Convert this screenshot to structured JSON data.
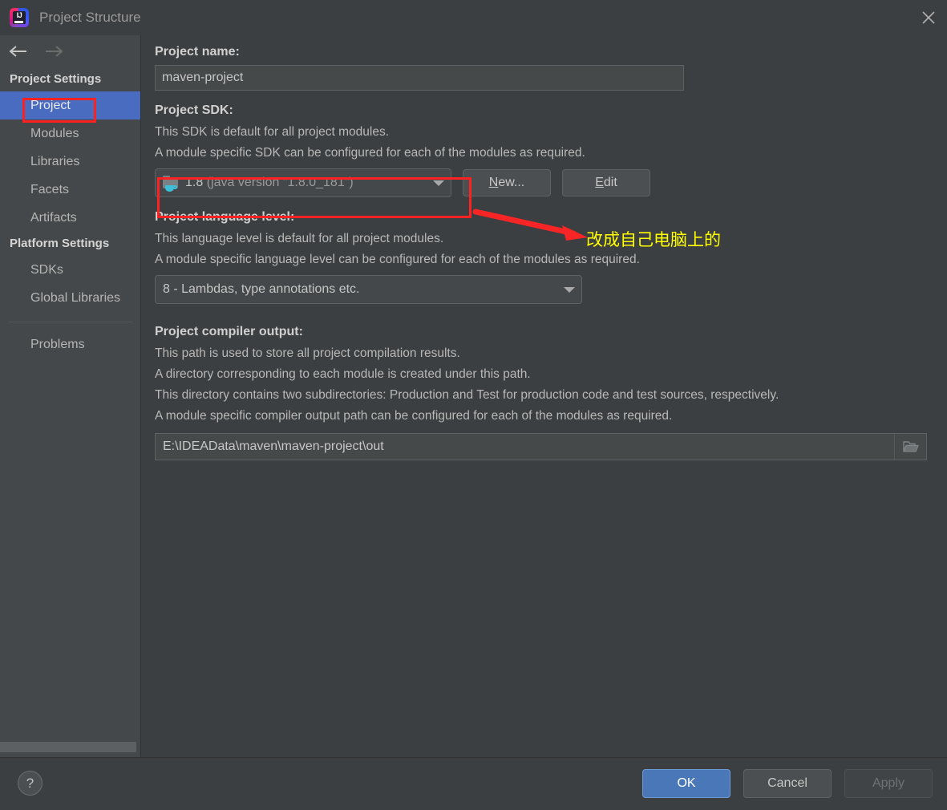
{
  "window": {
    "title": "Project Structure",
    "logo_icon": "intellij-idea-logo",
    "close_icon": "close-icon"
  },
  "sidebar": {
    "back_icon": "arrow-left-icon",
    "forward_icon": "arrow-right-icon",
    "groups": [
      {
        "header": "Project Settings",
        "items": [
          {
            "label": "Project",
            "selected": true
          },
          {
            "label": "Modules",
            "selected": false
          },
          {
            "label": "Libraries",
            "selected": false
          },
          {
            "label": "Facets",
            "selected": false
          },
          {
            "label": "Artifacts",
            "selected": false
          }
        ]
      },
      {
        "header": "Platform Settings",
        "items": [
          {
            "label": "SDKs",
            "selected": false
          },
          {
            "label": "Global Libraries",
            "selected": false
          }
        ]
      }
    ],
    "problems_label": "Problems"
  },
  "main": {
    "project_name": {
      "label": "Project name:",
      "value": "maven-project",
      "placeholder": "Project name"
    },
    "project_sdk": {
      "label": "Project SDK:",
      "description_line1": "This SDK is default for all project modules.",
      "description_line2": "A module specific SDK can be configured for each of the modules as required.",
      "selected_version": "1.8",
      "selected_detail": "(java version \"1.8.0_181\")",
      "sdk_icon": "java-sdk-folder-icon",
      "dropdown_icon": "chevron-down-icon",
      "new_button": "New...",
      "new_button_mnemonic": "N",
      "new_button_rest": "ew...",
      "edit_button": "Edit",
      "edit_button_mnemonic": "E",
      "edit_button_rest": "dit"
    },
    "language_level": {
      "label": "Project language level:",
      "description_line1": "This language level is default for all project modules.",
      "description_line2": "A module specific language level can be configured for each of the modules as required.",
      "value": "8 - Lambdas, type annotations etc.",
      "dropdown_icon": "chevron-down-icon"
    },
    "compiler_output": {
      "label": "Project compiler output:",
      "description_line1": "This path is used to store all project compilation results.",
      "description_line2": "A directory corresponding to each module is created under this path.",
      "description_line3": "This directory contains two subdirectories: Production and Test for production code and test sources, respectively.",
      "description_line4": "A module specific compiler output path can be configured for each of the modules as required.",
      "value": "E:\\IDEAData\\maven\\maven-project\\out",
      "browse_icon": "folder-open-icon"
    }
  },
  "annotations": {
    "highlight_color": "#fc2222",
    "note_color": "#ffff00",
    "note_text": "改成自己电脑上的",
    "arrow_icon": "red-arrow-icon"
  },
  "footer": {
    "help_icon": "question-mark-icon",
    "help_label": "?",
    "ok_label": "OK",
    "cancel_label": "Cancel",
    "apply_label": "Apply",
    "primary_color": "#4a77b8"
  }
}
